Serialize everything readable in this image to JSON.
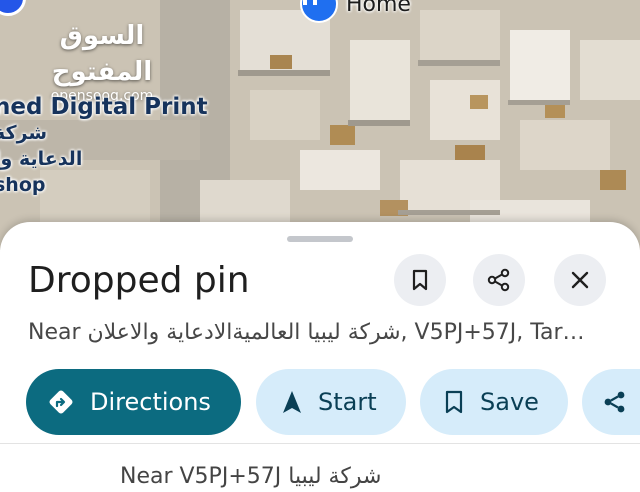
{
  "map": {
    "watermark_arabic": "السوق المفتوح",
    "watermark_site": "opensooq.com",
    "home_label": "Home",
    "poi_line1": "ned Digital Print",
    "poi_line2": "شركة",
    "poi_line3": "الدعاية وا",
    "poi_line4": "shop"
  },
  "place": {
    "title": "Dropped pin",
    "subtitle": "Near شركة ليبيا العالميةالادعاية والاعلان, V5PJ+57J, Tar…",
    "next_line": "Near V5PJ+57J شركة ليبيا"
  },
  "actions": {
    "directions": "Directions",
    "start": "Start",
    "save": "Save"
  },
  "colors": {
    "primary_button": "#0c6b80",
    "secondary_chip": "#d6ecfa",
    "home_pin": "#1f6ff0"
  },
  "icons": [
    "bookmark-icon",
    "share-icon",
    "close-icon",
    "directions-icon",
    "navigation-arrow-icon"
  ]
}
